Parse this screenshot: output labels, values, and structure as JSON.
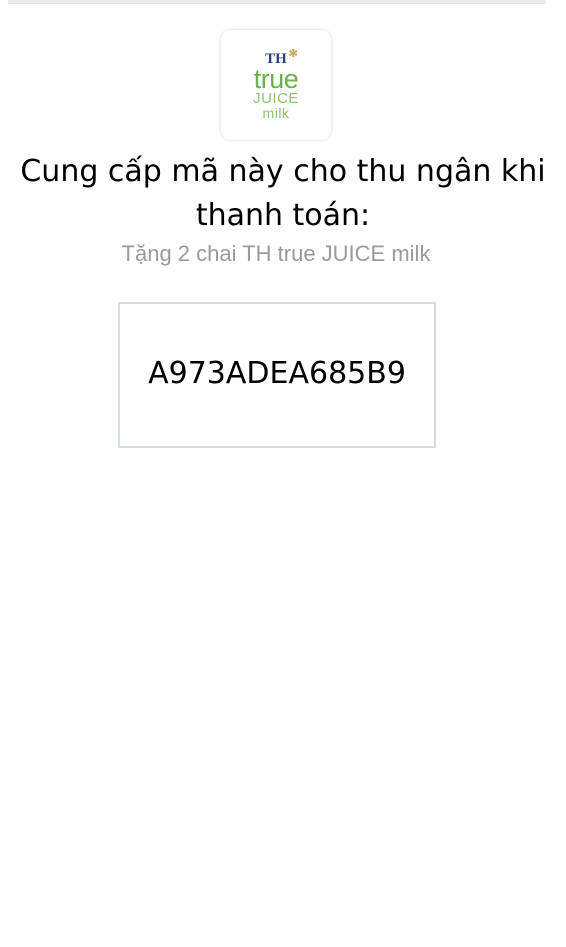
{
  "brand": {
    "th": "TH",
    "true": "true",
    "juice": "JUICE",
    "milk": "milk",
    "star_icon": "star-icon"
  },
  "instruction": "Cung cấp mã này cho thu ngân khi thanh toán:",
  "offer": "Tặng 2 chai TH true JUICE milk",
  "voucher": {
    "code": "A973ADEA685B9"
  },
  "colors": {
    "brand_navy": "#2a3e7a",
    "brand_green": "#6cb04c",
    "brand_light_green": "#8cc46c",
    "offer_text": "#9a9a9a",
    "code_border": "#d4dde4"
  }
}
